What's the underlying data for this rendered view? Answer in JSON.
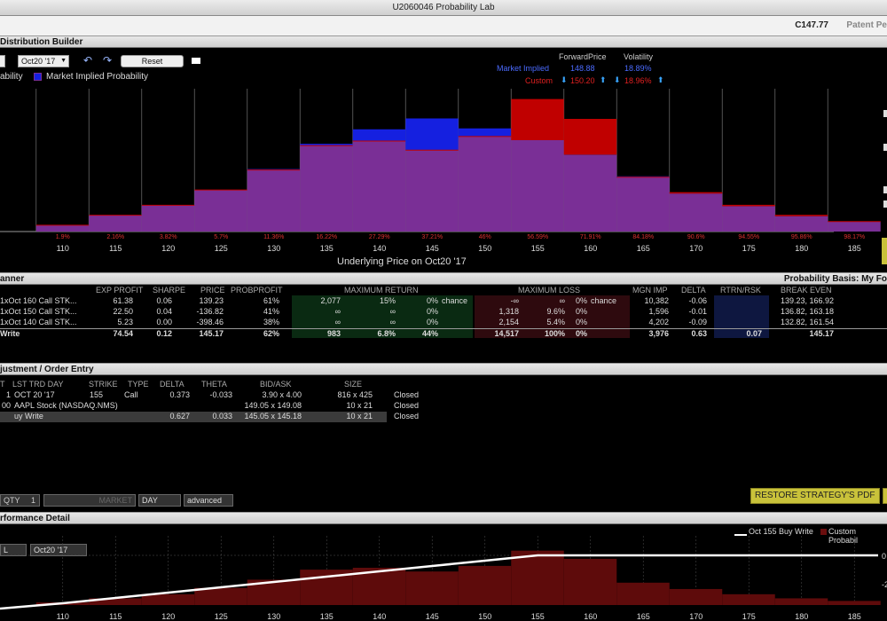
{
  "window": {
    "title": "U2060046 Probability Lab"
  },
  "ticker_bar": {
    "price": "C147.77",
    "patent": "Patent Pe"
  },
  "distribution": {
    "header": "Distribution Builder",
    "date": "Oct20 '17",
    "reset_label": "Reset",
    "legend_left": "ability",
    "legend_market": "Market Implied Probability",
    "col_forward": "ForwardPrice",
    "col_vol": "Volatility",
    "market_label": "Market Implied",
    "market_forward": "148.88",
    "market_vol": "18.89%",
    "custom_label": "Custom",
    "custom_forward": "150.20",
    "custom_vol": "18.96%",
    "axis_title": "Underlying Price on Oct20 '17",
    "colors": {
      "market": "#1520e0",
      "custom": "#c00000",
      "overlap": "#7a2f96"
    }
  },
  "chart_data": [
    {
      "type": "bar",
      "xlabel": "Underlying Price on Oct20 '17",
      "categories": [
        "110",
        "115",
        "120",
        "125",
        "130",
        "135",
        "140",
        "145",
        "150",
        "155",
        "160",
        "165",
        "170",
        "175",
        "180",
        "185"
      ],
      "cumulative_labels": [
        "1.9%",
        "2.16%",
        "3.82%",
        "5.7%",
        "11.36%",
        "16.22%",
        "27.29%",
        "37.21%",
        "46%",
        "56.59%",
        "71.91%",
        "84.18%",
        "90.6%",
        "94.55%",
        "95.86%",
        "98.17%"
      ],
      "series": [
        {
          "name": "Market Implied Probability",
          "values": [
            0.7,
            1.8,
            2.9,
            4.6,
            6.9,
            9.7,
            11.3,
            12.5,
            11.4,
            10.1,
            8.5,
            6.1,
            4.2,
            2.8,
            1.7,
            1.1
          ]
        },
        {
          "name": "Custom",
          "values": [
            0.7,
            1.8,
            2.9,
            4.6,
            6.8,
            9.5,
            10.0,
            9.0,
            10.5,
            14.6,
            12.4,
            6.0,
            4.3,
            2.9,
            1.8,
            1.1
          ]
        }
      ]
    },
    {
      "type": "line",
      "x": [
        110,
        115,
        120,
        125,
        130,
        135,
        140,
        145,
        150,
        155,
        160,
        165,
        170,
        175,
        180,
        185
      ],
      "series": [
        {
          "name": "Oct 155 Buy Write",
          "values": [
            -30,
            -25,
            -20,
            -15,
            -10,
            -5,
            0,
            5,
            10,
            15,
            15,
            15,
            15,
            15,
            15,
            15
          ]
        }
      ],
      "bars": [
        0.7,
        1.8,
        2.9,
        4.6,
        6.8,
        9.5,
        10.0,
        9.0,
        10.5,
        14.6,
        12.4,
        6.0,
        4.3,
        2.9,
        1.8,
        1.1
      ],
      "ytick_labels": [
        "0",
        "-2"
      ]
    }
  ],
  "planner": {
    "header": "anner",
    "basis": "Probability Basis: My Fo",
    "columns": {
      "exp_profit": "EXP PROFIT",
      "sharpe": "SHARPE",
      "price": "PRICE",
      "probprofit": "PROBPROFIT",
      "max_return": "MAXIMUM RETURN",
      "max_loss": "MAXIMUM LOSS",
      "mgn_imp": "MGN IMP",
      "delta": "DELTA",
      "rtrn_rsk": "RTRN/RSK",
      "break_even": "BREAK EVEN"
    },
    "rows": [
      {
        "name": "1xOct 160 Call STK...",
        "exp": "61.38",
        "sharpe": "0.06",
        "price": "139.23",
        "prob": "61%",
        "mr_val": "2,077",
        "mr_pct": "15%",
        "mr_ch": "0%",
        "mr_word": "chance",
        "ml_val": "-∞",
        "ml_pct": "∞",
        "ml_ch": "0%",
        "ml_word": "chance",
        "mgn": "10,382",
        "delta": "-0.06",
        "rr": "",
        "be": "139.23, 166.92"
      },
      {
        "name": "1xOct 150 Call STK...",
        "exp": "22.50",
        "sharpe": "0.04",
        "price": "-136.82",
        "prob": "41%",
        "mr_val": "∞",
        "mr_pct": "∞",
        "mr_ch": "0%",
        "mr_word": "",
        "ml_val": "1,318",
        "ml_pct": "9.6%",
        "ml_ch": "0%",
        "ml_word": "",
        "mgn": "1,596",
        "delta": "-0.01",
        "rr": "",
        "be": "136.82, 163.18"
      },
      {
        "name": "1xOct 140 Call STK...",
        "exp": "5.23",
        "sharpe": "0.00",
        "price": "-398.46",
        "prob": "38%",
        "mr_val": "∞",
        "mr_pct": "∞",
        "mr_ch": "0%",
        "mr_word": "",
        "ml_val": "2,154",
        "ml_pct": "5.4%",
        "ml_ch": "0%",
        "ml_word": "",
        "mgn": "4,202",
        "delta": "-0.09",
        "rr": "",
        "be": "132.82, 161.54"
      },
      {
        "name": "Write",
        "exp": "74.54",
        "sharpe": "0.12",
        "price": "145.17",
        "prob": "62%",
        "mr_val": "983",
        "mr_pct": "6.8%",
        "mr_ch": "44%",
        "mr_word": "",
        "ml_val": "14,517",
        "ml_pct": "100%",
        "ml_ch": "0%",
        "ml_word": "",
        "mgn": "3,976",
        "delta": "0.63",
        "rr": "0.07",
        "be": "145.17"
      }
    ]
  },
  "order": {
    "header": "justment / Order Entry",
    "columns": {
      "t": "T",
      "lst": "LST TRD DAY",
      "strike": "STRIKE",
      "type": "TYPE",
      "delta": "DELTA",
      "theta": "THETA",
      "bidask": "BID/ASK",
      "size": "SIZE"
    },
    "rows": [
      {
        "qty": "1",
        "lst": "OCT 20 '17",
        "strike": "155",
        "type": "Call",
        "delta": "0.373",
        "theta": "-0.033",
        "bidask": "3.90 x 4.00",
        "size": "816 x 425",
        "status": "Closed"
      },
      {
        "qty": "00",
        "lst": "AAPL Stock (NASDAQ.NMS)",
        "strike": "",
        "type": "",
        "delta": "",
        "theta": "",
        "bidask": "149.05 x 149.08",
        "size": "10 x 21",
        "status": "Closed"
      },
      {
        "qty": "",
        "lst": "uy Write",
        "strike": "",
        "type": "",
        "delta": "0.627",
        "theta": "0.033",
        "bidask": "145.05 x 145.18",
        "size": "10 x 21",
        "status": "Closed"
      }
    ],
    "qty_label": "QTY",
    "qty_value": "1",
    "market_label": "MARKET",
    "tif": "DAY",
    "advanced": "advanced",
    "restore_label": "RESTORE STRATEGY'S PDF"
  },
  "performance": {
    "header": "rformance Detail",
    "select_left": "L",
    "select_date": "Oct20 '17",
    "legend_line": "Oct 155 Buy Write",
    "legend_bar": "Custom Probabil"
  }
}
